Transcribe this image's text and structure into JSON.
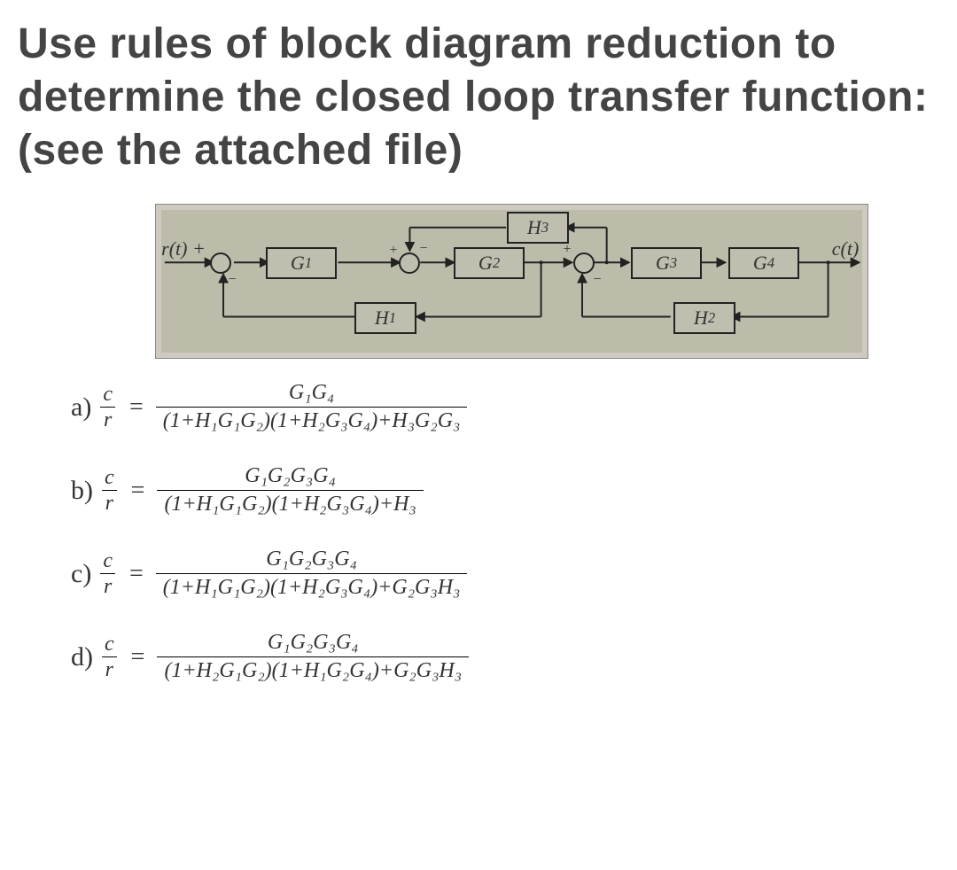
{
  "question": "Use rules of block diagram reduction to determine the closed loop transfer function:(see the attached file)",
  "diagram": {
    "input": "r(t)",
    "output": "c(t)",
    "blocks": {
      "g1": "G",
      "g2": "G",
      "g3": "G",
      "g4": "G",
      "h1": "H",
      "h2": "H",
      "h3": "H"
    },
    "subs": {
      "g1": "1",
      "g2": "2",
      "g3": "3",
      "g4": "4",
      "h1": "1",
      "h2": "2",
      "h3": "3"
    },
    "signs": {
      "s1p": "+",
      "s1m": "−",
      "s2p": "+",
      "s2m": "−",
      "s3p": "+",
      "s3m": "−"
    }
  },
  "options": {
    "a": {
      "letter": "a)",
      "num": "G₁G₄",
      "den": "(1+H₁G₁G₂)(1+H₂G₃G₄)+H₃G₂G₃"
    },
    "b": {
      "letter": "b)",
      "num": "G₁G₂G₃G₄",
      "den": "(1+H₁G₁G₂)(1+H₂G₃G₄)+H₃"
    },
    "c": {
      "letter": "c)",
      "num": "G₁G₂G₃G₄",
      "den": "(1+H₁G₁G₂)(1+H₂G₃G₄)+G₂G₃H₃"
    },
    "d": {
      "letter": "d)",
      "num": "G₁G₂G₃G₄",
      "den": "(1+H₂G₁G₂)(1+H₁G₂G₄)+G₂G₃H₃"
    }
  },
  "ratio": {
    "num": "c",
    "den": "r",
    "eq": "="
  }
}
